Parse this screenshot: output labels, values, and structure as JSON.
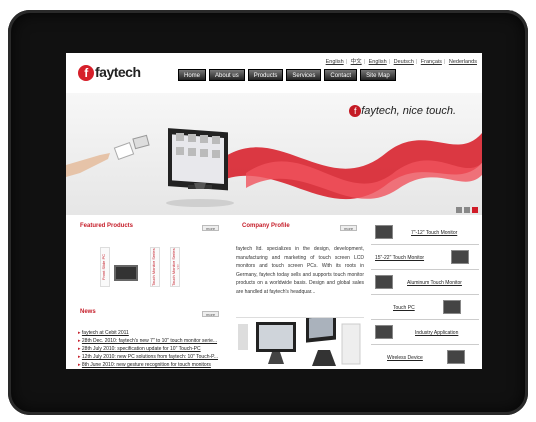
{
  "languages": [
    "English",
    "中文",
    "English",
    "Deutsch",
    "Français",
    "Nederlands"
  ],
  "logo": {
    "text": "faytech"
  },
  "nav": [
    "Home",
    "About us",
    "Products",
    "Services",
    "Contact",
    "Site Map"
  ],
  "banner": {
    "brand": "faytech",
    "slogan": "nice touch."
  },
  "featured": {
    "title": "Featured Products",
    "more": "more",
    "labels": [
      "Front Slide PC",
      "Touch Monitor Series",
      "Touch Monitor Series 12\""
    ]
  },
  "company": {
    "title": "Company Profile",
    "more": "more",
    "text": "faytech ltd. specializes in the design, development, manufacturing and marketing of touch screen LCD monitors and touch screen PCs. With its roots in Germany, faytech today sells and supports touch monitor products on a worldwide basis. Design and global sales are handled at faytech's headquar..."
  },
  "news": {
    "title": "News",
    "more": "more",
    "items": [
      "faytech at Cebit 2011",
      "28th Dec. 2010: faytech's new 7\" to 10\" touch monitor serie...",
      "28th July 2010: specification update for 10\" Touch-PC",
      "12th July 2010: new PC solutions from faytech: 10\" Touch-P...",
      "8th June 2010: new gesture recognition for touch monitors"
    ]
  },
  "side_menu": [
    "7\"-12\" Touch Monitor",
    "15\"-22\" Touch Monitor",
    "Aluminum Touch Monitor",
    "Touch PC",
    "Industry Application",
    "Wireless Device"
  ],
  "colors": {
    "brand_red": "#c51c28",
    "bezel": "#111111",
    "nav_bg": "#333333"
  }
}
